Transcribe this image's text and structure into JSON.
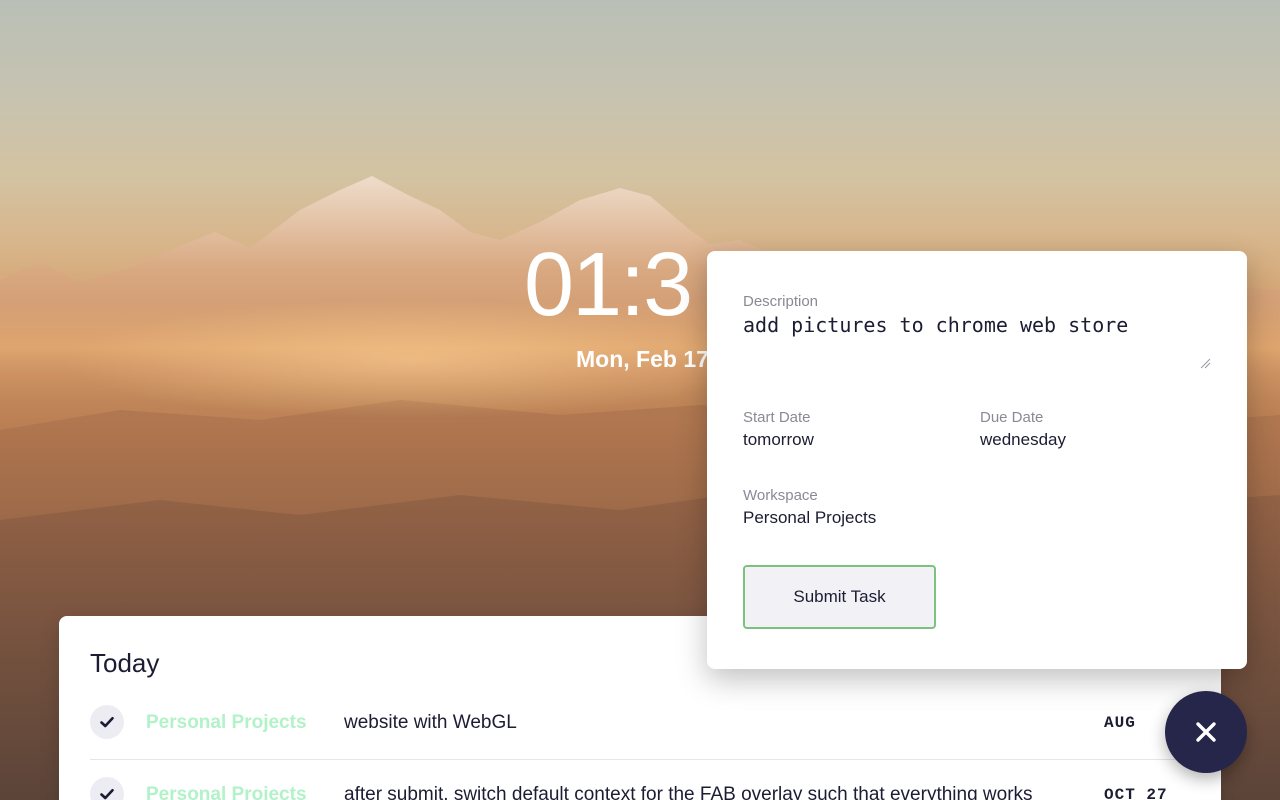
{
  "clock": {
    "time": "01:3",
    "date": "Mon, Feb 17"
  },
  "today": {
    "title": "Today",
    "tasks": [
      {
        "workspace": "Personal Projects",
        "text": "website with WebGL",
        "due": "AUG"
      },
      {
        "workspace": "Personal Projects",
        "text": "after submit, switch default context for the FAB overlay such that everything works",
        "due": "OCT 27"
      }
    ]
  },
  "form": {
    "description_label": "Description",
    "description_value": "add pictures to chrome web store",
    "start_label": "Start Date",
    "start_value": "tomorrow",
    "due_label": "Due Date",
    "due_value": "wednesday",
    "workspace_label": "Workspace",
    "workspace_value": "Personal Projects",
    "submit_label": "Submit Task"
  },
  "fab": {
    "icon": "close-icon"
  },
  "colors": {
    "workspace_tag": "#b2f2c8",
    "fab": "#26254a",
    "submit_border": "#7bc27e",
    "text_dark": "#1c1c33"
  }
}
